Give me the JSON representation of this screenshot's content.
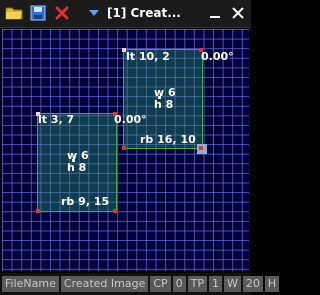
{
  "window": {
    "title": "[1] Creat..."
  },
  "toolbar": {
    "open_icon": "folder-open-icon",
    "save_icon": "save-icon",
    "close_icon": "close-x-icon",
    "dropdown_icon": "dropdown-arrow-icon"
  },
  "canvas": {
    "rect1": {
      "lt": "lt 10, 2",
      "angle": "0.00°",
      "w": "w 6",
      "h": "h 8",
      "rb": "rb 16, 10"
    },
    "rect2": {
      "lt": "lt 3, 7",
      "angle": "0.00°",
      "w": "w 6",
      "h": "h 8",
      "rb": "rb 9, 15"
    }
  },
  "statusbar": {
    "filename": "FileName",
    "image": "Created Image",
    "cp_label": "CP",
    "cp_value": "0",
    "tp_label": "TP",
    "tp_value": "1",
    "w_label": "W",
    "w_value": "20",
    "h_label": "H"
  },
  "colors": {
    "grid": "#6e6edc",
    "canvas_bg": "#00003a",
    "rect_border": "#3cae3c",
    "selection_red": "#e33131"
  }
}
